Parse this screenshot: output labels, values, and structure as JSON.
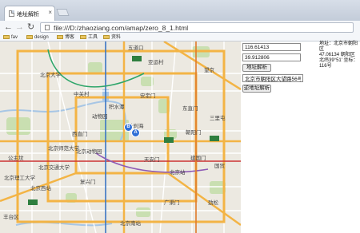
{
  "browser": {
    "tab_title": "地址解析",
    "tab_close": "×",
    "back_glyph": "←",
    "forward_glyph": "→",
    "reload_glyph": "↻",
    "url": "file:///D:/zhaoziang.com/amap/zero_8_1.html"
  },
  "bookmarks": [
    {
      "label": "fav"
    },
    {
      "label": "design"
    },
    {
      "label": "博客"
    },
    {
      "label": "工具"
    },
    {
      "label": "资料"
    }
  ],
  "map": {
    "labels": [
      {
        "text": "五道口"
      },
      {
        "text": "中关村"
      },
      {
        "text": "北京大学"
      },
      {
        "text": "北京理工大学"
      },
      {
        "text": "北京师范大学"
      },
      {
        "text": "动物园"
      },
      {
        "text": "北京动物园"
      },
      {
        "text": "积水潭"
      },
      {
        "text": "什刹海"
      },
      {
        "text": "安定门"
      },
      {
        "text": "东直门"
      },
      {
        "text": "朝阳门"
      },
      {
        "text": "建国门"
      },
      {
        "text": "天安门"
      },
      {
        "text": "北京站"
      },
      {
        "text": "北京西站"
      },
      {
        "text": "复兴门"
      },
      {
        "text": "公主坟"
      },
      {
        "text": "北京南站"
      },
      {
        "text": "三里屯"
      },
      {
        "text": "国贸"
      },
      {
        "text": "西直门"
      },
      {
        "text": "亚运村"
      },
      {
        "text": "望京"
      },
      {
        "text": "劲松"
      },
      {
        "text": "广渠门"
      },
      {
        "text": "丰台区"
      },
      {
        "text": "北京交通大学"
      }
    ],
    "marker_a": "A",
    "marker_b": "B",
    "colors": {
      "land": "#ece9e1",
      "park": "#c9dfb1",
      "water": "#a7c6e5",
      "highway": "#f3b445",
      "road": "#ffffff"
    }
  },
  "panel": {
    "lng_value": "116.61413",
    "lat_value": "39.912806",
    "geo_button": "地址解析",
    "address_value": "北京市朝阳区大望路56号",
    "regeo_button": "逆地址解析",
    "result_lines": [
      "地址：北京市朝阳区",
      "47.06134 朝阳区",
      "北纬39°51' 坐标：",
      "116号"
    ]
  }
}
